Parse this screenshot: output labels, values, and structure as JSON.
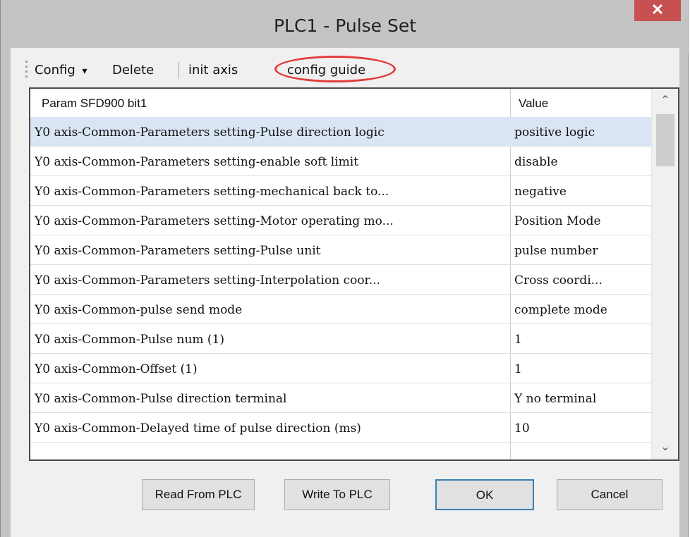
{
  "window": {
    "title": "PLC1 - Pulse  Set",
    "close_glyph": "✕"
  },
  "toolbar": {
    "config": "Config",
    "config_arrow": "▾",
    "delete": "Delete",
    "init_axis": "init axis",
    "config_guide": "config guide"
  },
  "grid": {
    "headers": {
      "param": "Param SFD900 bit1",
      "value": "Value"
    },
    "rows": [
      {
        "param": "Y0 axis-Common-Parameters setting-Pulse direction logic",
        "value": "positive logic",
        "selected": true
      },
      {
        "param": "Y0 axis-Common-Parameters setting-enable soft limit",
        "value": "disable"
      },
      {
        "param": "Y0 axis-Common-Parameters setting-mechanical back to...",
        "value": "negative"
      },
      {
        "param": "Y0 axis-Common-Parameters setting-Motor operating mo...",
        "value": "Position Mode"
      },
      {
        "param": "Y0 axis-Common-Parameters setting-Pulse unit",
        "value": "pulse number"
      },
      {
        "param": "Y0 axis-Common-Parameters setting-Interpolation coor...",
        "value": "Cross coordi..."
      },
      {
        "param": "Y0 axis-Common-pulse send mode",
        "value": "complete mode"
      },
      {
        "param": "Y0 axis-Common-Pulse num (1)",
        "value": "1"
      },
      {
        "param": "Y0 axis-Common-Offset (1)",
        "value": "1"
      },
      {
        "param": "Y0 axis-Common-Pulse direction terminal",
        "value": "Y no terminal"
      },
      {
        "param": "Y0 axis-Common-Delayed time of pulse direction (ms)",
        "value": "10"
      }
    ],
    "scroll_up": "⌃",
    "scroll_down": "⌄"
  },
  "buttons": {
    "read": "Read From PLC",
    "write": "Write To PLC",
    "ok": "OK",
    "cancel": "Cancel"
  },
  "colors": {
    "selected_row": "#d9e5f4",
    "close_button": "#c75050",
    "highlight_circle": "#e23b3b"
  }
}
